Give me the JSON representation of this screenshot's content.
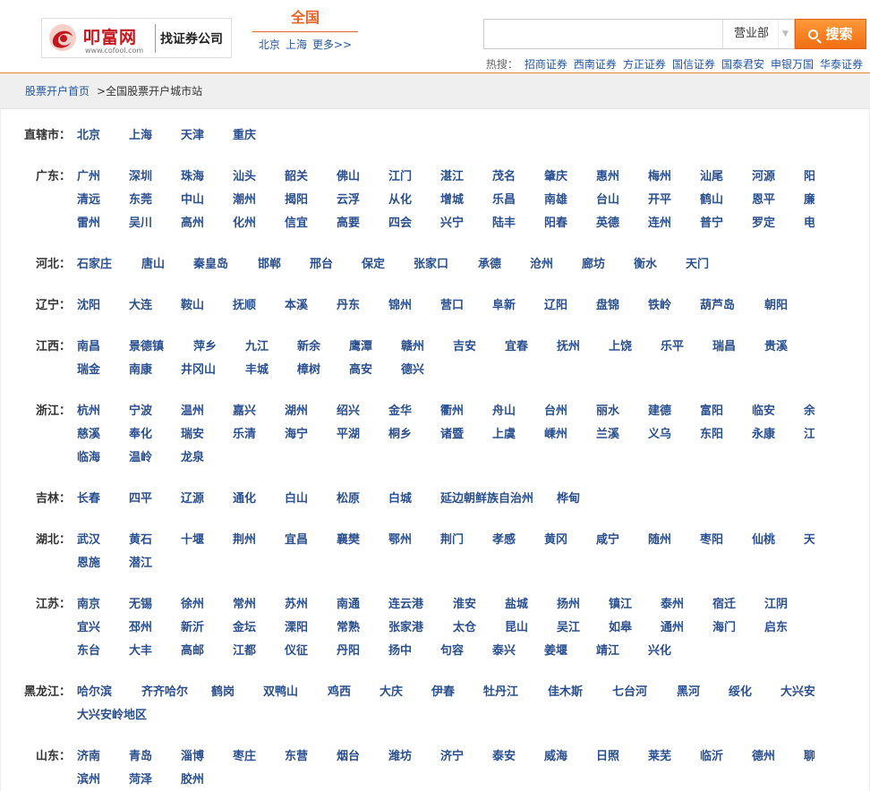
{
  "header": {
    "brand": "叩富网",
    "brand_url": "www.cofool.com",
    "slogan": "找证券公司",
    "current_city": "全国",
    "city_links": [
      "北京",
      "上海",
      "更多>>"
    ],
    "search": {
      "placeholder": "",
      "select_value": "营业部",
      "button_label": "搜索"
    },
    "hot_label": "热搜：",
    "hot_keywords": [
      "招商证券",
      "西南证券",
      "方正证券",
      "国信证券",
      "国泰君安",
      "申银万国",
      "华泰证券"
    ]
  },
  "breadcrumb": {
    "home": "股票开户首页",
    "current": ">全国股票开户城市站"
  },
  "colors": {
    "accent_orange": "#f26d12",
    "link_blue": "#2a4f8f",
    "city_red": "#e8632a"
  },
  "provinces": [
    {
      "name": "直辖市：",
      "lines": [
        [
          "北京",
          "上海",
          "天津",
          "重庆"
        ]
      ]
    },
    {
      "name": "广东：",
      "lines": [
        [
          "广州",
          "深圳",
          "珠海",
          "汕头",
          "韶关",
          "佛山",
          "江门",
          "湛江",
          "茂名",
          "肇庆",
          "惠州",
          "梅州",
          "汕尾",
          "河源",
          "阳江"
        ],
        [
          "清远",
          "东莞",
          "中山",
          "潮州",
          "揭阳",
          "云浮",
          "从化",
          "增城",
          "乐昌",
          "南雄",
          "台山",
          "开平",
          "鹤山",
          "恩平",
          "廉江"
        ],
        [
          "雷州",
          "吴川",
          "高州",
          "化州",
          "信宜",
          "高要",
          "四会",
          "兴宁",
          "陆丰",
          "阳春",
          "英德",
          "连州",
          "普宁",
          "罗定",
          "电白"
        ]
      ]
    },
    {
      "name": "河北：",
      "lines": [
        [
          "石家庄",
          "唐山",
          "秦皇岛",
          "邯郸",
          "邢台",
          "保定",
          "张家口",
          "承德",
          "沧州",
          "廊坊",
          "衡水",
          "天门"
        ]
      ]
    },
    {
      "name": "辽宁：",
      "lines": [
        [
          "沈阳",
          "大连",
          "鞍山",
          "抚顺",
          "本溪",
          "丹东",
          "锦州",
          "营口",
          "阜新",
          "辽阳",
          "盘锦",
          "铁岭",
          "葫芦岛",
          "朝阳"
        ]
      ]
    },
    {
      "name": "江西：",
      "lines": [
        [
          "南昌",
          "景德镇",
          "萍乡",
          "九江",
          "新余",
          "鹰潭",
          "赣州",
          "吉安",
          "宜春",
          "抚州",
          "上饶",
          "乐平",
          "瑞昌",
          "贵溪"
        ],
        [
          "瑞金",
          "南康",
          "井冈山",
          "丰城",
          "樟树",
          "高安",
          "德兴"
        ]
      ]
    },
    {
      "name": "浙江：",
      "lines": [
        [
          "杭州",
          "宁波",
          "温州",
          "嘉兴",
          "湖州",
          "绍兴",
          "金华",
          "衢州",
          "舟山",
          "台州",
          "丽水",
          "建德",
          "富阳",
          "临安",
          "余杭"
        ],
        [
          "慈溪",
          "奉化",
          "瑞安",
          "乐清",
          "海宁",
          "平湖",
          "桐乡",
          "诸暨",
          "上虞",
          "嵊州",
          "兰溪",
          "义乌",
          "东阳",
          "永康",
          "江山"
        ],
        [
          "临海",
          "温岭",
          "龙泉"
        ]
      ]
    },
    {
      "name": "吉林：",
      "lines": [
        [
          "长春",
          "四平",
          "辽源",
          "通化",
          "白山",
          "松原",
          "白城",
          "延边朝鲜族自治州",
          "桦甸"
        ]
      ]
    },
    {
      "name": "湖北：",
      "lines": [
        [
          "武汉",
          "黄石",
          "十堰",
          "荆州",
          "宜昌",
          "襄樊",
          "鄂州",
          "荆门",
          "孝感",
          "黄冈",
          "咸宁",
          "随州",
          "枣阳",
          "仙桃",
          "天门"
        ],
        [
          "恩施",
          "潜江"
        ]
      ]
    },
    {
      "name": "江苏：",
      "lines": [
        [
          "南京",
          "无锡",
          "徐州",
          "常州",
          "苏州",
          "南通",
          "连云港",
          "淮安",
          "盐城",
          "扬州",
          "镇江",
          "泰州",
          "宿迁",
          "江阴"
        ],
        [
          "宜兴",
          "邳州",
          "新沂",
          "金坛",
          "溧阳",
          "常熟",
          "张家港",
          "太仓",
          "昆山",
          "吴江",
          "如皋",
          "通州",
          "海门",
          "启东"
        ],
        [
          "东台",
          "大丰",
          "高邮",
          "江都",
          "仪征",
          "丹阳",
          "扬中",
          "句容",
          "泰兴",
          "姜堰",
          "靖江",
          "兴化"
        ]
      ]
    },
    {
      "name": "黑龙江：",
      "lines": [
        [
          "哈尔滨",
          "齐齐哈尔",
          "鹤岗",
          "双鸭山",
          "鸡西",
          "大庆",
          "伊春",
          "牡丹江",
          "佳木斯",
          "七台河",
          "黑河",
          "绥化",
          "大兴安岭"
        ],
        [
          "大兴安岭地区"
        ]
      ]
    },
    {
      "name": "山东：",
      "lines": [
        [
          "济南",
          "青岛",
          "淄博",
          "枣庄",
          "东营",
          "烟台",
          "潍坊",
          "济宁",
          "泰安",
          "威海",
          "日照",
          "莱芜",
          "临沂",
          "德州",
          "聊城"
        ],
        [
          "滨州",
          "菏泽",
          "胶州"
        ]
      ]
    }
  ]
}
